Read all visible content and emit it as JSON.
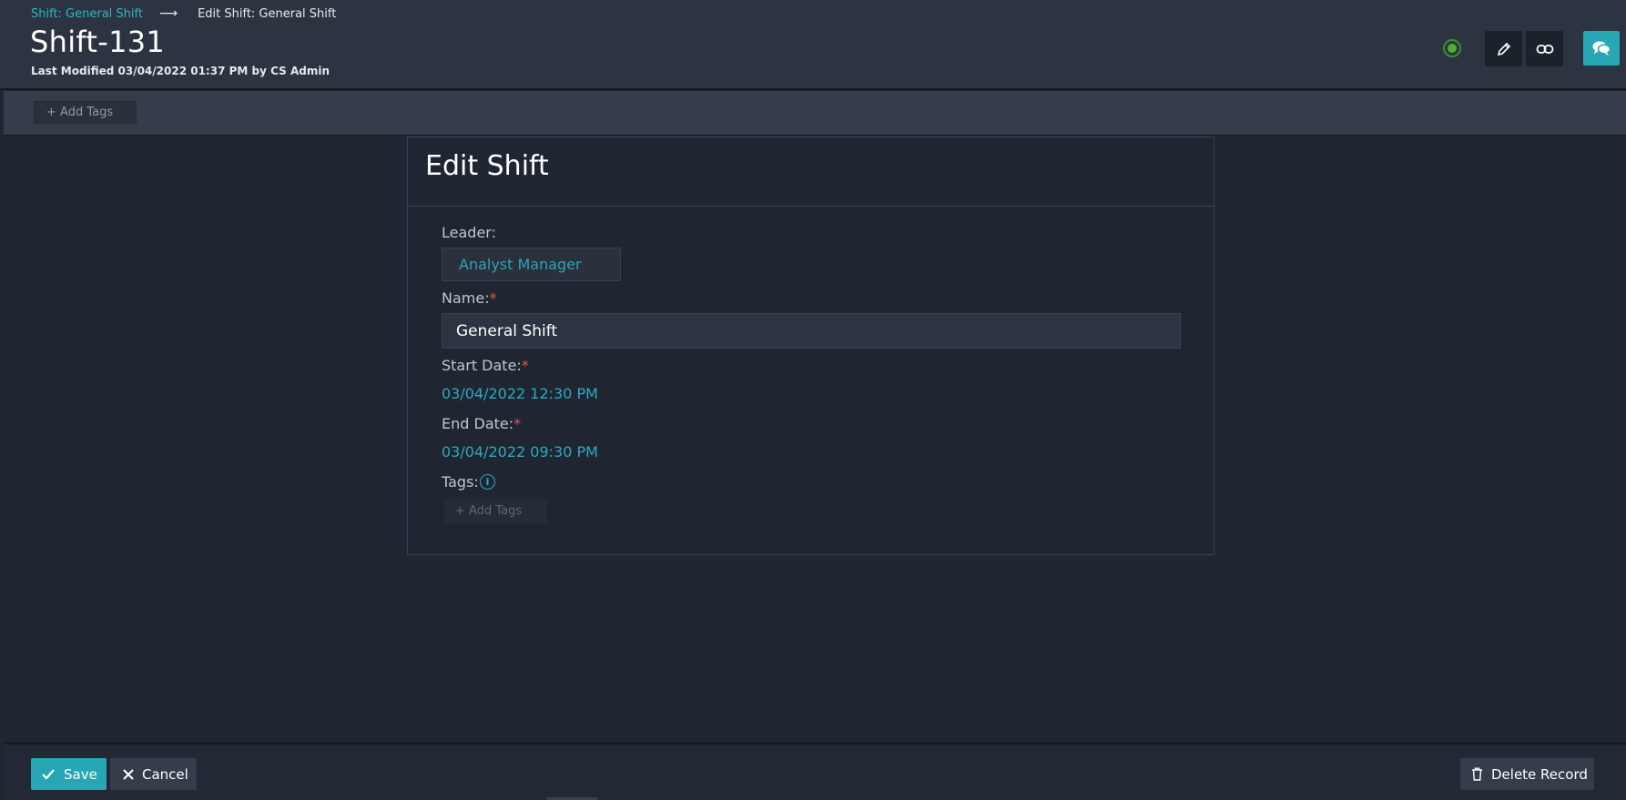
{
  "breadcrumb": {
    "parent": "Shift: General Shift",
    "current": "Edit Shift: General Shift"
  },
  "record": {
    "title": "Shift-131",
    "modified": "Last Modified 03/04/2022 01:37 PM by CS Admin"
  },
  "header_icons": [
    "status-icon",
    "pencil-icon",
    "link-icon",
    "chat-icon"
  ],
  "tags_bar": {
    "add_label": "+ Add Tags"
  },
  "form": {
    "title": "Edit Shift",
    "leader": {
      "label": "Leader:",
      "value": "Analyst Manager"
    },
    "name": {
      "label": "Name:",
      "value": "General Shift",
      "required": "*"
    },
    "start_date": {
      "label": "Start Date:",
      "value": "03/04/2022 12:30 PM",
      "required": "*"
    },
    "end_date": {
      "label": "End Date:",
      "value": "03/04/2022 09:30 PM",
      "required": "*"
    },
    "tags": {
      "label": "Tags:",
      "info": "i",
      "add_label": "+ Add Tags"
    }
  },
  "footer": {
    "save_label": "Save",
    "cancel_label": "Cancel",
    "delete_label": "Delete Record"
  },
  "colors": {
    "accent": "#27a6b4",
    "link": "#2fb5c0",
    "required": "#e05555",
    "status": "#4caf2e"
  }
}
